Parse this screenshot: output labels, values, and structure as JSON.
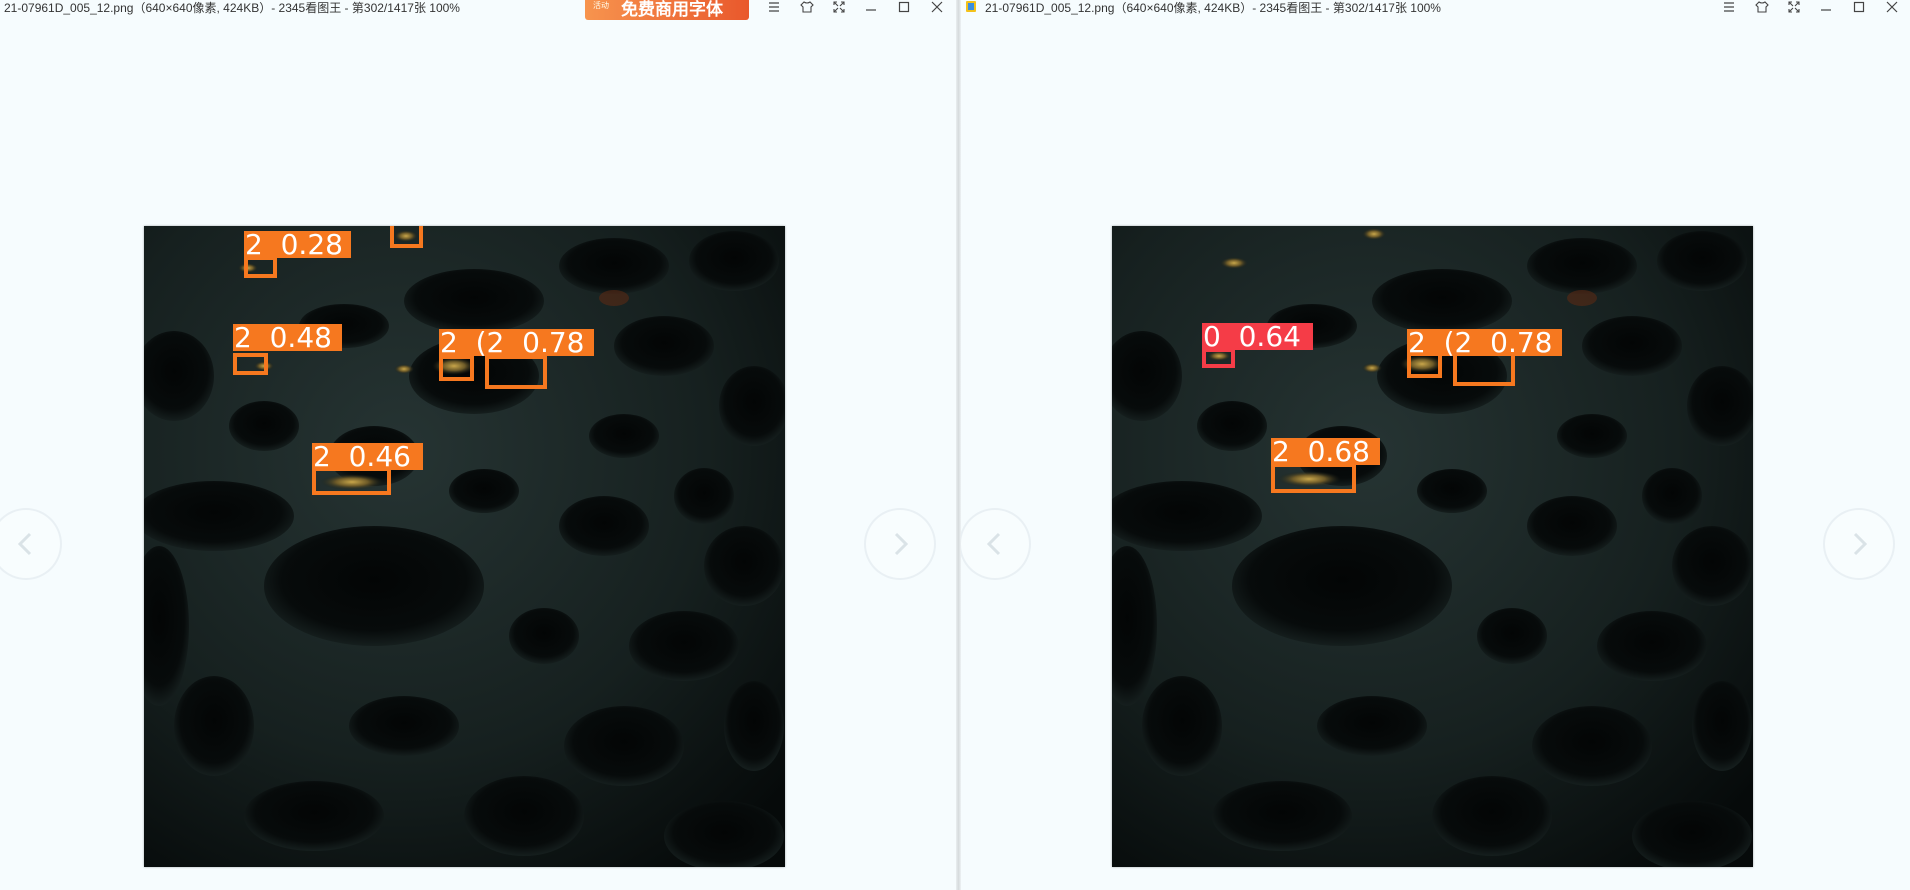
{
  "colors": {
    "class2": "#f6781f",
    "class0": "#f53c47",
    "background": "#f6fcfe"
  },
  "left_window": {
    "title": "21-07961D_005_12.png（640×640像素, 424KB）- 2345看图王 - 第302/1417张 100%",
    "ad_banner": {
      "badge": "活动",
      "text": "免费商用字体"
    },
    "controls": [
      "menu-icon",
      "skin-icon",
      "fullscreen-icon",
      "minimize-icon",
      "maximize-icon",
      "close-icon"
    ],
    "detections": [
      {
        "label": "2  0.28"
      },
      {
        "label": "2  0.48"
      },
      {
        "label": "2  (2  0.78"
      },
      {
        "label": "2  0.46"
      }
    ]
  },
  "right_window": {
    "title": "21-07961D_005_12.png（640×640像素, 424KB）- 2345看图王 - 第302/1417张 100%",
    "controls": [
      "menu-icon",
      "skin-icon",
      "fullscreen-icon",
      "minimize-icon",
      "maximize-icon",
      "close-icon"
    ],
    "detections": [
      {
        "label": "0  0.64"
      },
      {
        "label": "2  (2  0.78"
      },
      {
        "label": "2  0.68"
      }
    ]
  }
}
